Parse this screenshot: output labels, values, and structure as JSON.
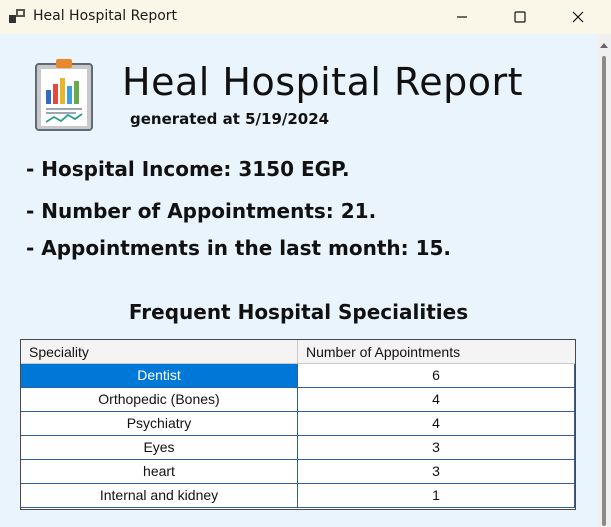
{
  "window": {
    "title": "Heal Hospital Report",
    "controls": {
      "minimize_icon": "minimize-icon",
      "maximize_icon": "maximize-icon",
      "close_icon": "close-icon"
    }
  },
  "report": {
    "title": "Heal Hospital Report",
    "generated": "generated at 5/19/2024",
    "stats": [
      "- Hospital Income: 3150 EGP.",
      "- Number of Appointments: 21.",
      "- Appointments in the last month: 15."
    ]
  },
  "specialities": {
    "title": "Frequent Hospital Specialities",
    "columns": [
      "Speciality",
      "Number of Appointments"
    ],
    "rows": [
      {
        "name": "Dentist",
        "count": "6",
        "selected": true
      },
      {
        "name": "Orthopedic (Bones)",
        "count": "4"
      },
      {
        "name": "Psychiatry",
        "count": "4"
      },
      {
        "name": "Eyes",
        "count": "3"
      },
      {
        "name": "heart",
        "count": "3"
      },
      {
        "name": "Internal and kidney",
        "count": "1"
      }
    ]
  },
  "colors": {
    "titlebar_bg": "#fbf7e8",
    "client_bg": "#eaf4fc",
    "selection": "#0078d7",
    "grid_lines": "#2e5fa3"
  }
}
